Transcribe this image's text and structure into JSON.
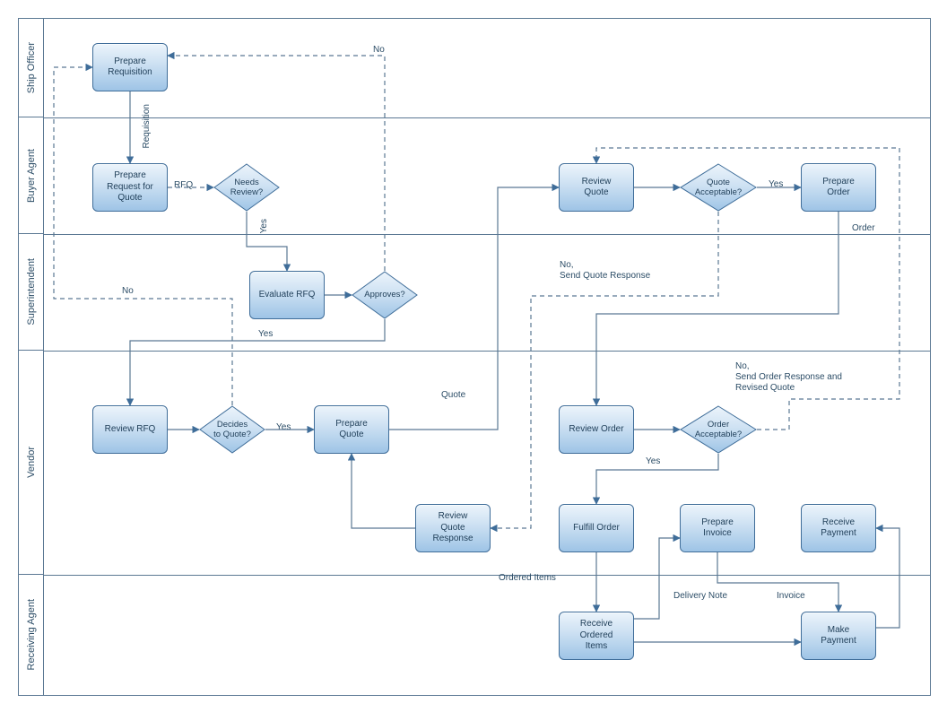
{
  "lanes": {
    "ship_officer": "Ship Officer",
    "buyer_agent": "Buyer Agent",
    "superintendent": "Superintendent",
    "vendor": "Vendor",
    "receiving_agent": "Receiving Agent"
  },
  "nodes": {
    "prepare_requisition": "Prepare\nRequisition",
    "prepare_rfq": "Prepare\nRequest for\nQuote",
    "needs_review": "Needs\nReview?",
    "evaluate_rfq": "Evaluate RFQ",
    "approves": "Approves?",
    "review_rfq": "Review RFQ",
    "decides_to_quote": "Decides\nto Quote?",
    "prepare_quote": "Prepare\nQuote",
    "review_quote": "Review\nQuote",
    "quote_acceptable": "Quote\nAcceptable?",
    "prepare_order": "Prepare\nOrder",
    "review_order": "Review Order",
    "order_acceptable": "Order\nAcceptable?",
    "review_quote_response": "Review\nQuote\nResponse",
    "fulfill_order": "Fulfill Order",
    "prepare_invoice": "Prepare\nInvoice",
    "receive_payment": "Receive\nPayment",
    "receive_ordered_items": "Receive\nOrdered\nItems",
    "make_payment": "Make\nPayment"
  },
  "labels": {
    "requisition": "Requisition",
    "rfq": "RFQ",
    "yes1": "Yes",
    "no1": "No",
    "yes2": "Yes",
    "no2": "No",
    "yes3": "Yes",
    "quote": "Quote",
    "yes4": "Yes",
    "no_send_quote_response": "No,\nSend Quote Response",
    "order": "Order",
    "yes5": "Yes",
    "no_send_order_response": "No,\nSend Order Response and\nRevised Quote",
    "ordered_items": "Ordered Items",
    "delivery_note": "Delivery Note",
    "invoice": "Invoice"
  },
  "colors": {
    "line": "#5b7893",
    "arrow": "#3f6d99"
  }
}
